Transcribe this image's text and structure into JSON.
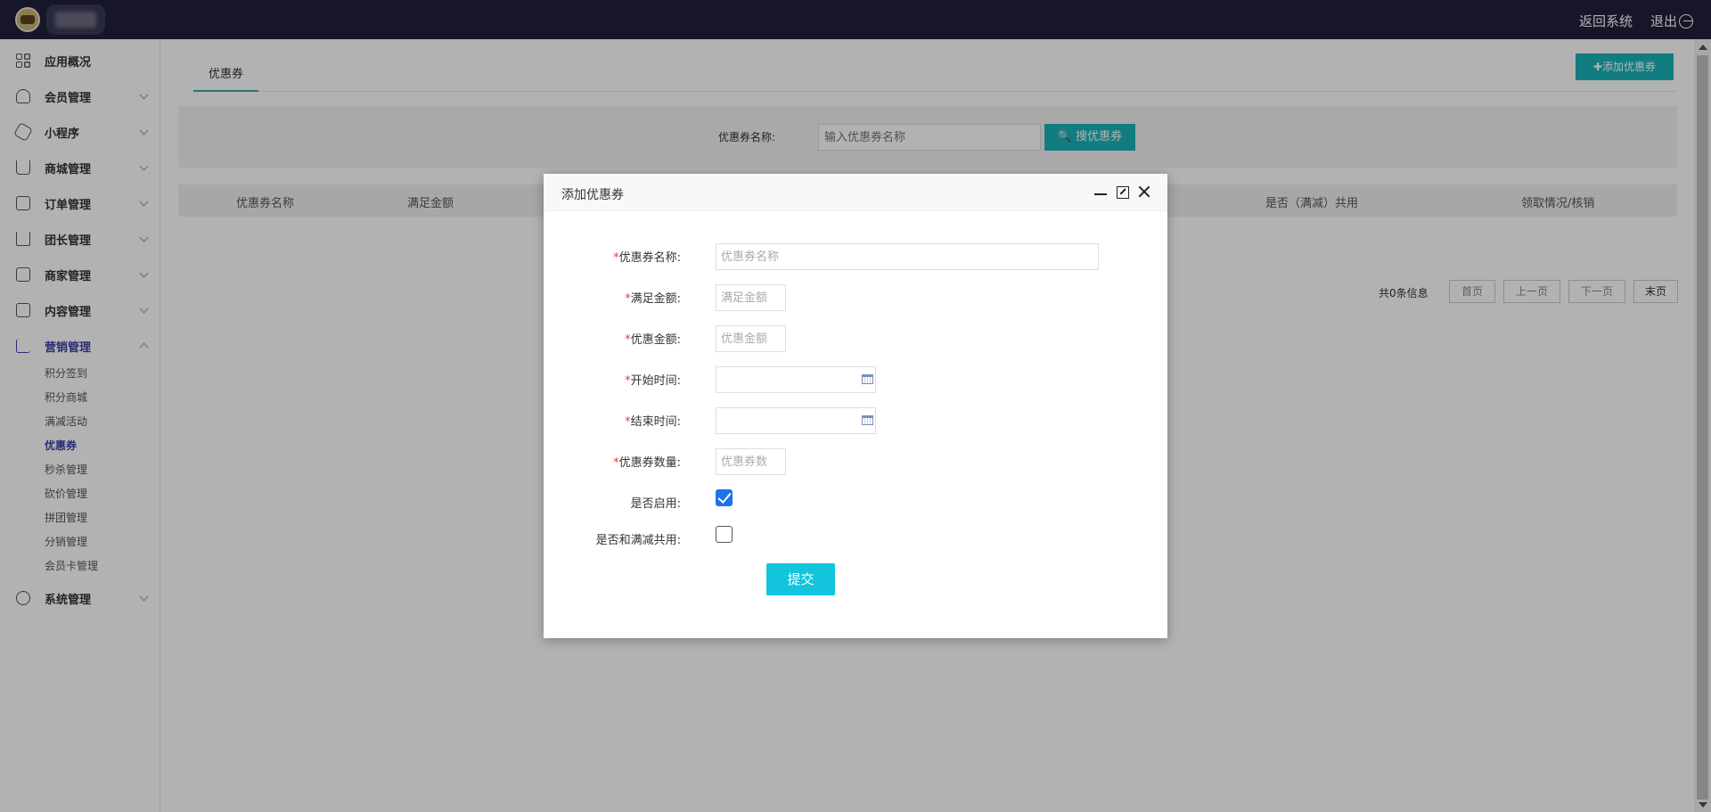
{
  "topbar": {
    "back_label": "返回系统",
    "logout_label": "退出"
  },
  "sidebar": {
    "items": [
      {
        "label": "应用概况",
        "icon": "grid-icon"
      },
      {
        "label": "会员管理",
        "icon": "user-icon"
      },
      {
        "label": "小程序",
        "icon": "miniprogram-icon"
      },
      {
        "label": "商城管理",
        "icon": "cart-icon"
      },
      {
        "label": "订单管理",
        "icon": "order-icon"
      },
      {
        "label": "团长管理",
        "icon": "crown-icon"
      },
      {
        "label": "商家管理",
        "icon": "store-icon"
      },
      {
        "label": "内容管理",
        "icon": "document-icon"
      },
      {
        "label": "营销管理",
        "icon": "chart-icon"
      },
      {
        "label": "系统管理",
        "icon": "gear-icon"
      }
    ],
    "marketing_sub": [
      "积分签到",
      "积分商城",
      "满减活动",
      "优惠券",
      "秒杀管理",
      "砍价管理",
      "拼团管理",
      "分销管理",
      "会员卡管理"
    ],
    "active_sub": "优惠券"
  },
  "main": {
    "tab_label": "优惠券",
    "add_button": "✚添加优惠券",
    "search_label": "优惠券名称:",
    "search_placeholder": "输入优惠券名称",
    "search_button": "搜优惠券",
    "columns": [
      "优惠券名称",
      "满足金额",
      "是否（满减）共用",
      "领取情况/核销"
    ],
    "pager": {
      "info": "共0条信息",
      "first": "首页",
      "prev": "上一页",
      "next": "下一页",
      "last": "末页"
    }
  },
  "modal": {
    "title": "添加优惠券",
    "fields": {
      "name_label": "优惠券名称:",
      "name_placeholder": "优惠券名称",
      "amount_label": "满足金额:",
      "amount_placeholder": "满足金额",
      "discount_label": "优惠金额:",
      "discount_placeholder": "优惠金额",
      "start_label": "开始时间:",
      "end_label": "结束时间:",
      "count_label": "优惠券数量:",
      "count_placeholder": "优惠券数",
      "enabled_label": "是否启用:",
      "enabled": true,
      "shared_label": "是否和满减共用:",
      "shared": false
    },
    "submit_label": "提交"
  },
  "colors": {
    "topbar": "#20203a",
    "accent": "#1ab3b8",
    "submit": "#12c4dc",
    "active_nav": "#3b3fa8",
    "required": "#e23b3b"
  }
}
